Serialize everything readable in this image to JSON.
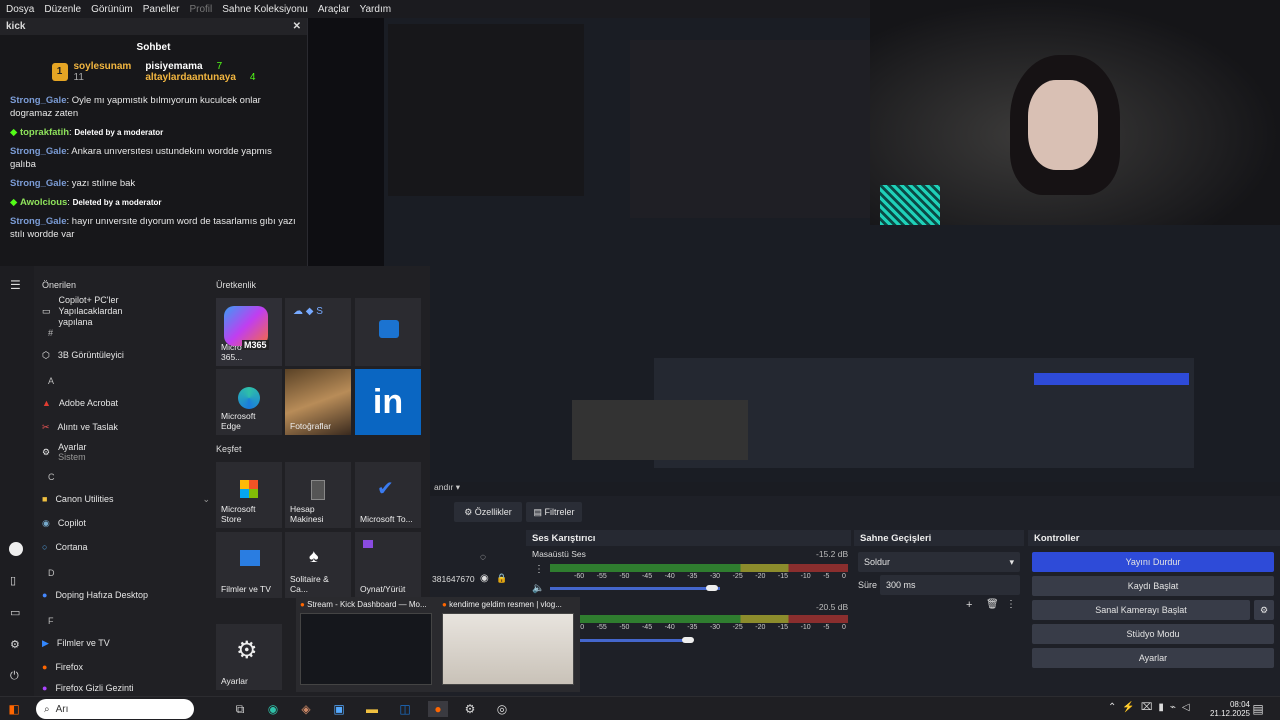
{
  "menubar": [
    "Dosya",
    "Düzenle",
    "Görünüm",
    "Paneller",
    "Profil",
    "Sahne Koleksiyonu",
    "Araçlar",
    "Yardım"
  ],
  "chat": {
    "window_title": "kick",
    "title": "Sohbet",
    "gifters": [
      {
        "name": "soylesunam",
        "rank": "1",
        "count": "11"
      },
      {
        "name": "pisiyemama",
        "count": "7"
      },
      {
        "name": "altaylardaantunaya",
        "count": "4"
      }
    ],
    "messages": [
      {
        "user": "Strong_Gale",
        "text": "Oyle mı yapmıstık bılmıyorum kuculcek onlar dogramaz zaten"
      },
      {
        "user": "toprakfatih",
        "text": "Deleted by a moderator",
        "mod": true
      },
      {
        "user": "Strong_Gale",
        "text": "Ankara unıversıtesı ustundekını wordde yapmıs galıba"
      },
      {
        "user": "Strong_Gale",
        "text": "yazı stılıne bak"
      },
      {
        "user": "Awolcious",
        "text": "Deleted by a moderator",
        "mod": true
      },
      {
        "user": "Strong_Gale",
        "text": "hayır unıversıte dıyorum word de tasarlamıs gıbı yazı stılı wordde var"
      }
    ]
  },
  "startmenu": {
    "recommended_label": "Önerilen",
    "productivity_label": "Üretkenlik",
    "explore_label": "Keşfet",
    "apps": [
      {
        "letter": "",
        "name": "Copilot+ PC'ler Yapılacaklardan yapılana"
      },
      {
        "letter": "#",
        "name": "3B Görüntüleyici"
      },
      {
        "letter": "A",
        "name": "Adobe Acrobat"
      },
      {
        "letter": "",
        "name": "Alıntı ve Taslak"
      },
      {
        "letter": "",
        "name": "Ayarlar",
        "sub": "Sistem"
      },
      {
        "letter": "C",
        "name": "Canon Utilities"
      },
      {
        "letter": "",
        "name": "Copilot"
      },
      {
        "letter": "",
        "name": "Cortana"
      },
      {
        "letter": "D",
        "name": "Doping Hafıza Desktop"
      },
      {
        "letter": "F",
        "name": "Filmler ve TV"
      },
      {
        "letter": "",
        "name": "Firefox"
      },
      {
        "letter": "",
        "name": "Firefox Gizli Gezinti"
      }
    ],
    "tiles": {
      "m365": "Microsoft 365...",
      "m365_badge": "M365",
      "edge": "Microsoft Edge",
      "photos": "Fotoğraflar",
      "store": "Microsoft Store",
      "calc": "Hesap Makinesi",
      "todo": "Microsoft To...",
      "films": "Filmler ve TV",
      "solitaire": "Solitaire & Ca...",
      "play": "Oynat/Yürüt",
      "settings": "Ayarlar",
      "linkedin": "in"
    }
  },
  "obs": {
    "scene_dropdown": "andır",
    "props_btn": "Özellikler",
    "filters_btn": "Filtreler",
    "source_id": "381647670",
    "mixer_title": "Ses Karıştırıcı",
    "mixer": [
      {
        "name": "Masaüstü Ses",
        "db": "-15.2 dB",
        "level": 0.64
      },
      {
        "name": "",
        "db": "-20.5 dB",
        "level": 0.55
      }
    ],
    "ticks": [
      "-60",
      "-55",
      "-50",
      "-45",
      "-40",
      "-35",
      "-30",
      "-25",
      "-20",
      "-15",
      "-10",
      "-5",
      "0"
    ],
    "transitions_title": "Sahne Geçişleri",
    "transition": "Soldur",
    "duration_label": "Süre",
    "duration": "300 ms",
    "controls_title": "Kontroller",
    "controls": [
      "Yayını Durdur",
      "Kaydı Başlat",
      "Sanal Kamerayı Başlat",
      "Stüdyo Modu",
      "Ayarlar"
    ]
  },
  "thumbs": [
    {
      "title": "Stream - Kick Dashboard — Mo..."
    },
    {
      "title": "kendime geldim resmen | vlog..."
    }
  ],
  "taskbar": {
    "search_text": "Arı",
    "time": "08:04",
    "date": "21.12.2025"
  },
  "colors": {
    "accent": "#2e4bd8",
    "username": "#7b9cd6",
    "kick_green": "#53fc18"
  }
}
